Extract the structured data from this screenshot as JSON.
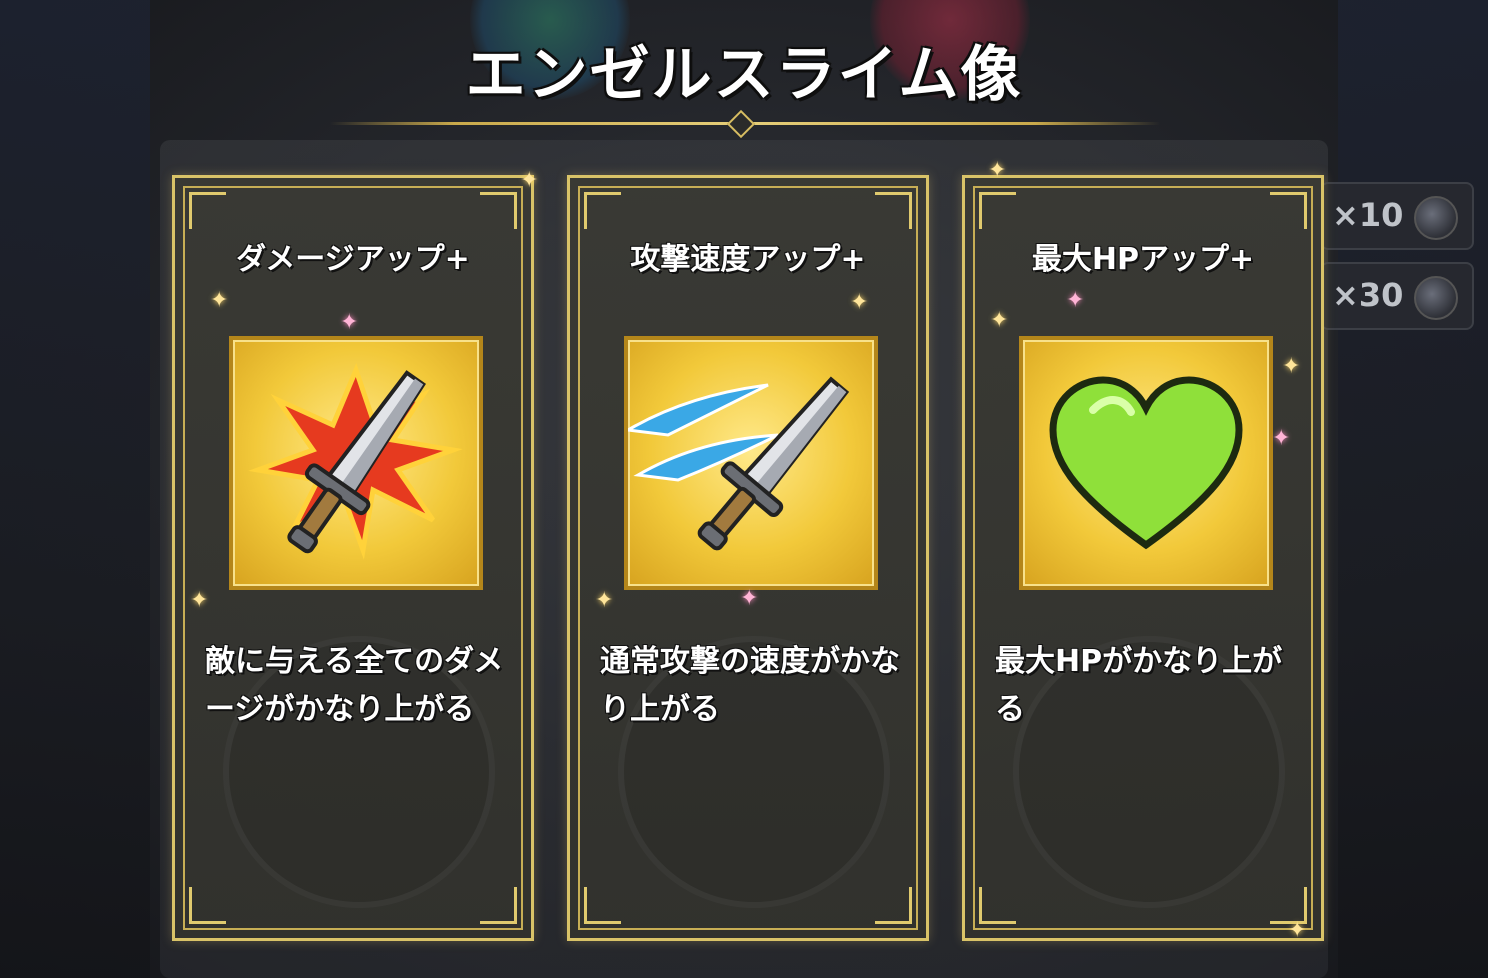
{
  "screen": {
    "title": "エンゼルスライム像"
  },
  "counters": [
    {
      "label": "×10",
      "icon": "orb-icon"
    },
    {
      "label": "×30",
      "icon": "orb-icon"
    }
  ],
  "cards": [
    {
      "title": "ダメージアップ+",
      "icon": "sword-burst-icon",
      "description": "敵に与える全てのダメージがかなり上がる"
    },
    {
      "title": "攻撃速度アップ+",
      "icon": "sword-speed-icon",
      "description": "通常攻撃の速度がかなり上がる"
    },
    {
      "title": "最大HPアップ+",
      "icon": "heart-icon",
      "description": "最大HPがかなり上がる"
    }
  ],
  "colors": {
    "frame_gold": "#d9c368",
    "icon_bg": "#f2c93a",
    "heart_green": "#8fe03a",
    "burst_red": "#e63a1f",
    "speed_blue": "#3aa8e6"
  }
}
